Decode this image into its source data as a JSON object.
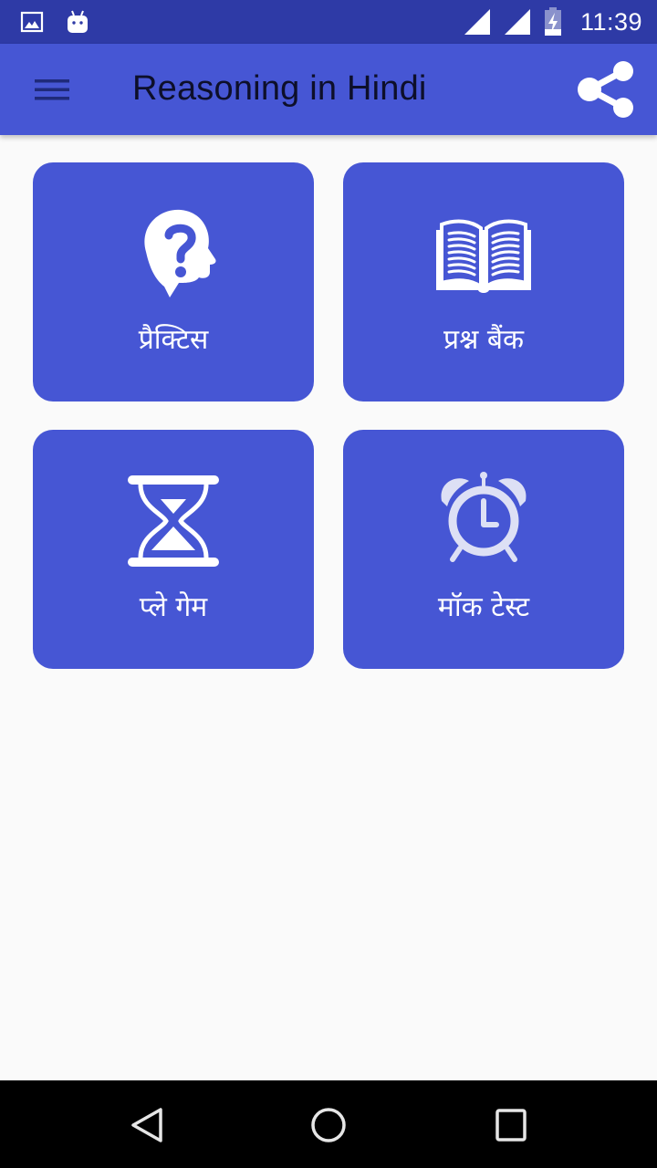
{
  "status_bar": {
    "time": "11:39",
    "left_icons": [
      "image-notification-icon",
      "android-notification-icon"
    ],
    "right_icons": [
      "signal-icon",
      "signal-icon",
      "battery-charging-icon"
    ]
  },
  "app_bar": {
    "title": "Reasoning in Hindi",
    "menu_icon": "hamburger-menu-icon",
    "share_icon": "share-icon"
  },
  "tiles": [
    {
      "label": "प्रैक्टिस",
      "icon": "head-question-icon"
    },
    {
      "label": "प्रश्न बैंक",
      "icon": "open-book-icon"
    },
    {
      "label": "प्ले गेम",
      "icon": "hourglass-icon"
    },
    {
      "label": "मॉक टेस्ट",
      "icon": "alarm-clock-icon"
    }
  ],
  "colors": {
    "status_bar": "#2e3aa6",
    "primary": "#4656d4",
    "background": "#fafafa",
    "title_text": "#0d0f2a",
    "nav_bar": "#000000"
  },
  "nav_bar": {
    "buttons": [
      "back",
      "home",
      "recents"
    ]
  }
}
